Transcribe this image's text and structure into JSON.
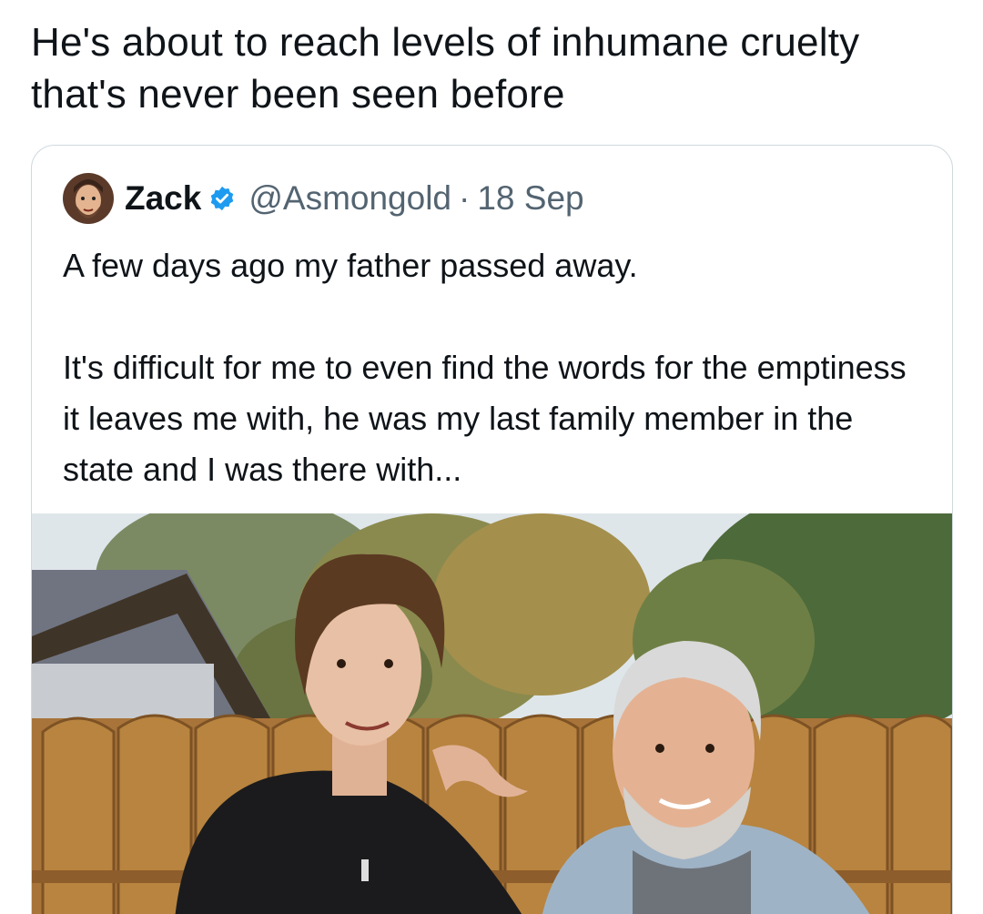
{
  "post": {
    "text": "He's about to reach levels of inhumane cruelty that's never been seen before"
  },
  "quoted_post": {
    "display_name": "Zack",
    "handle": "@Asmongold",
    "separator": "·",
    "date": "18 Sep",
    "verified_icon": "verified-badge-icon",
    "accent_color": "#1d9bf0",
    "body_lines": [
      "A few days ago my father passed away.",
      "It's difficult for me to even find the words for the emptiness it leaves me with, he was my last family member in the state and I was there with..."
    ]
  }
}
